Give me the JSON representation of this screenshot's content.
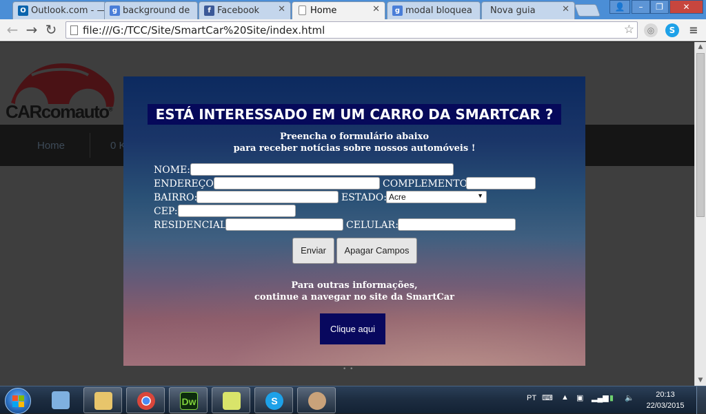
{
  "browser": {
    "tabs": [
      {
        "label": "Outlook.com - —",
        "icon": "outlook-icon",
        "icon_char": "O",
        "icon_color": "#0a64ad"
      },
      {
        "label": "background de",
        "icon": "google-icon",
        "icon_char": "g",
        "icon_color": "#4a7ed8"
      },
      {
        "label": "Facebook",
        "icon": "facebook-icon",
        "icon_char": "f",
        "icon_color": "#3b5998"
      },
      {
        "label": "Home",
        "icon": "page-icon",
        "icon_char": "",
        "icon_color": "#ffffff"
      },
      {
        "label": "modal bloquea",
        "icon": "google-icon",
        "icon_char": "g",
        "icon_color": "#4a7ed8"
      },
      {
        "label": "Nova guia",
        "icon": "",
        "icon_char": "",
        "icon_color": ""
      }
    ],
    "active_tab": 3,
    "url": "file:///G:/TCC/Site/SmartCar%20Site/index.html",
    "window_buttons": [
      "–",
      "❐",
      "✕"
    ]
  },
  "site": {
    "logo_text": "CARcomauto",
    "logo_mark": "®",
    "nav": [
      "Home",
      "0 K"
    ],
    "pager": "• •"
  },
  "modal": {
    "title": "ESTÁ INTERESSADO EM UM CARRO DA SMARTCAR ?",
    "intro_line1": "Preencha o formulário abaixo",
    "intro_line2": "para receber notícias sobre nossos automóveis !",
    "fields": {
      "nome_label": "NOME:",
      "endereco_label": "ENDEREÇO:",
      "complemento_label": "COMPLEMENTO:",
      "bairro_label": "BAIRRO:",
      "estado_label": "ESTADO:",
      "estado_value": "Acre",
      "cep_label": "CEP:",
      "residencial_label": "RESIDENCIAL:",
      "celular_label": "CELULAR:"
    },
    "submit_label": "Enviar",
    "reset_label": "Apagar Campos",
    "outro_line1": "Para outras informações,",
    "outro_line2": "continue a navegar no site da SmartCar",
    "cta_label": "Clique aqui"
  },
  "taskbar": {
    "apps": [
      {
        "name": "virtualbox-icon",
        "char": "",
        "color": "#7fb0e0"
      },
      {
        "name": "file-explorer-icon",
        "char": "",
        "color": "#e8c56b"
      },
      {
        "name": "chrome-icon",
        "char": "",
        "color": "#d9463b"
      },
      {
        "name": "dreamweaver-icon",
        "char": "Dw",
        "color": "#2f7c2f"
      },
      {
        "name": "sticky-notes-icon",
        "char": "",
        "color": "#d9e46a"
      },
      {
        "name": "skype-icon",
        "char": "S",
        "color": "#1da1e8"
      },
      {
        "name": "paint-icon",
        "char": "",
        "color": "#c9a27a"
      }
    ],
    "language": "PT",
    "time": "20:13",
    "date": "22/03/2015"
  }
}
